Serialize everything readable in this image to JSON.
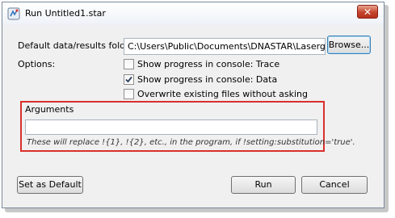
{
  "window": {
    "title": "Run Untitled1.star",
    "close_symbol": "✕"
  },
  "folder": {
    "label": "Default data/results folder:",
    "value": "C:\\Users\\Public\\Documents\\DNASTAR\\Lasergene",
    "browse_label": "Browse..."
  },
  "options": {
    "label": "Options:",
    "items": [
      {
        "label": "Show progress in console: Trace",
        "checked": false
      },
      {
        "label": "Show progress in console: Data",
        "checked": true
      },
      {
        "label": "Overwrite existing files without asking",
        "checked": false
      }
    ]
  },
  "arguments": {
    "title": "Arguments",
    "value": "",
    "hint": "These will replace !{1}, !{2}, etc., in the program, if !setting:substitution='true'."
  },
  "buttons": {
    "set_default": "Set as Default",
    "run": "Run",
    "cancel": "Cancel"
  },
  "colors": {
    "highlight_frame": "#d9302b",
    "accent": "#3c7fb1"
  }
}
